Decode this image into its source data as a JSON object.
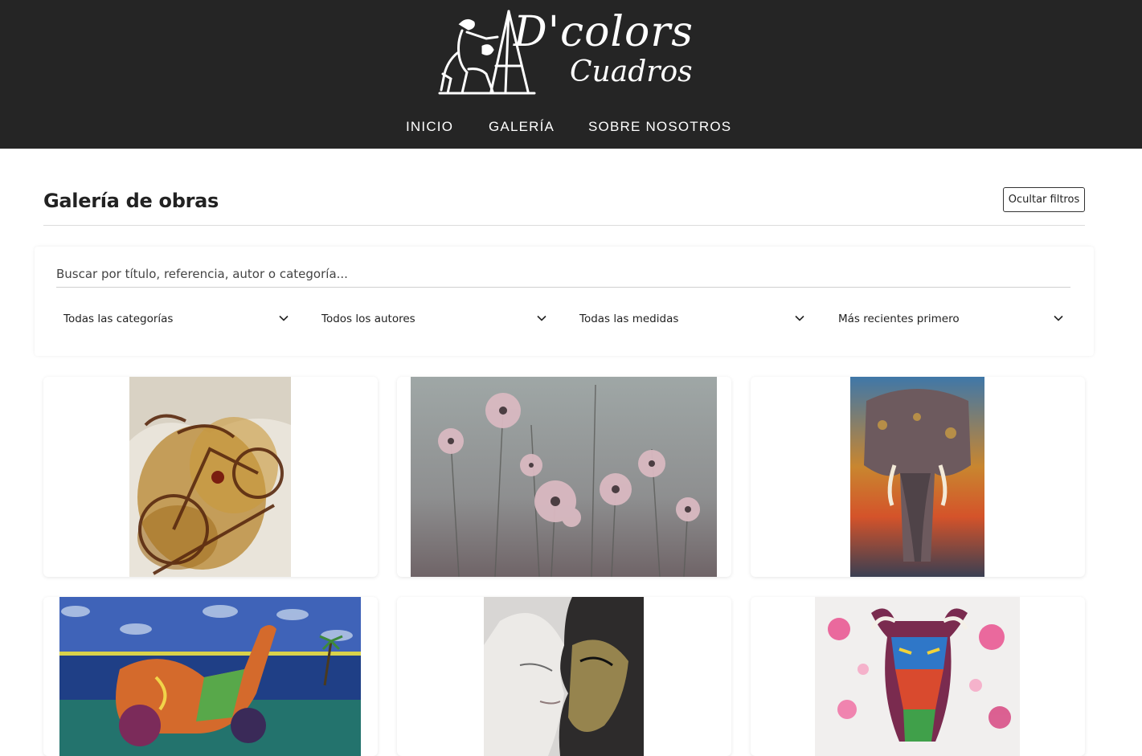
{
  "brand": {
    "line1": "D'colors",
    "line2": "Cuadros"
  },
  "nav": {
    "items": [
      "INICIO",
      "GALERÍA",
      "SOBRE NOSOTROS"
    ]
  },
  "page": {
    "title": "Galería de obras",
    "toggle_filters_label": "Ocultar filtros"
  },
  "filters": {
    "search_placeholder": "Buscar por título, referencia, autor o categoría...",
    "category_value": "Todas las categorías",
    "author_value": "Todos los autores",
    "size_value": "Todas las medidas",
    "sort_value": "Más recientes primero"
  },
  "gallery": {
    "items": [
      {
        "subject": "bicycle-painting"
      },
      {
        "subject": "poppies-painting"
      },
      {
        "subject": "elephant-painting"
      },
      {
        "subject": "scooter-painting"
      },
      {
        "subject": "faces-painting"
      },
      {
        "subject": "bull-painting"
      }
    ]
  },
  "colors": {
    "header_bg": "#252525",
    "page_bg": "#ffffff",
    "text": "#222222"
  }
}
